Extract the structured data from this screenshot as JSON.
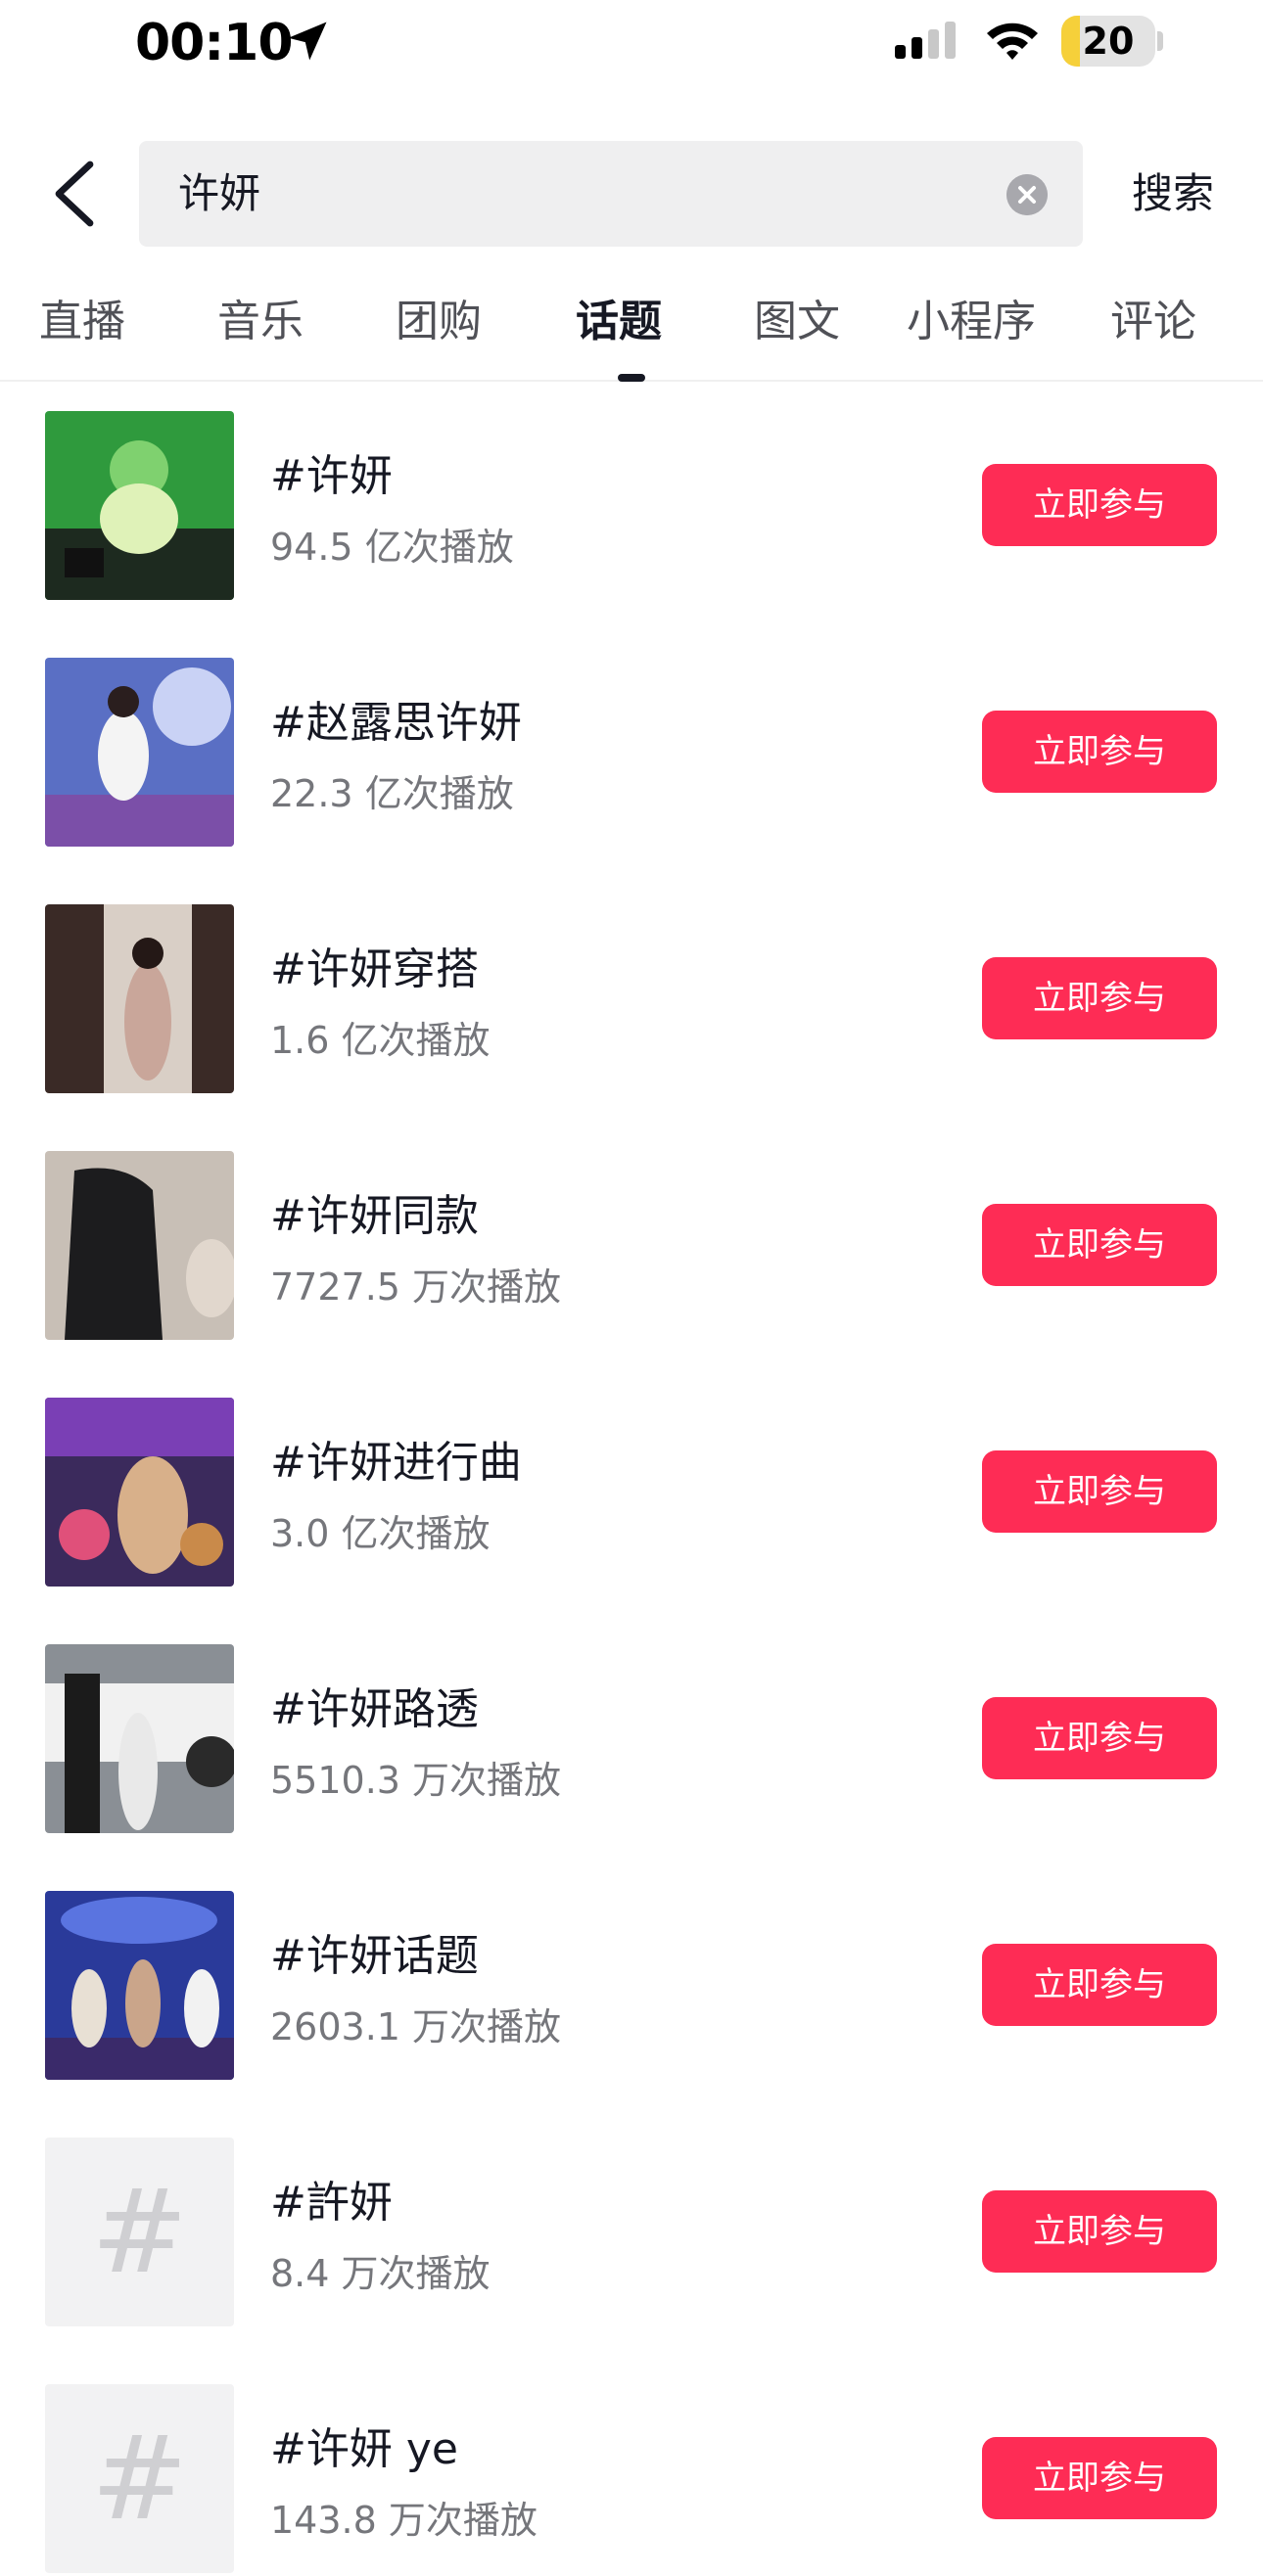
{
  "status_bar": {
    "time": "00:10",
    "battery": "20",
    "battery_level": 0.2,
    "icons": [
      "location-arrow-icon",
      "cellular-signal-icon",
      "wifi-icon",
      "battery-icon"
    ]
  },
  "search": {
    "back_icon": "chevron-left-icon",
    "query": "许妍",
    "clear_icon": "clear-circle-icon",
    "submit_label": "搜索"
  },
  "tabs": [
    {
      "label": "直播"
    },
    {
      "label": "音乐"
    },
    {
      "label": "团购"
    },
    {
      "label": "话题",
      "active": true
    },
    {
      "label": "图文"
    },
    {
      "label": "小程序"
    },
    {
      "label": "评论"
    }
  ],
  "topics": [
    {
      "title": "#许妍",
      "plays": "94.5 亿次播放",
      "thumbnail": "photo"
    },
    {
      "title": "#赵露思许妍",
      "plays": "22.3 亿次播放",
      "thumbnail": "photo"
    },
    {
      "title": "#许妍穿搭",
      "plays": "1.6 亿次播放",
      "thumbnail": "photo"
    },
    {
      "title": "#许妍同款",
      "plays": "7727.5 万次播放",
      "thumbnail": "photo"
    },
    {
      "title": "#许妍进行曲",
      "plays": "3.0 亿次播放",
      "thumbnail": "photo"
    },
    {
      "title": "#许妍路透",
      "plays": "5510.3 万次播放",
      "thumbnail": "photo"
    },
    {
      "title": "#许妍话题",
      "plays": "2603.1 万次播放",
      "thumbnail": "photo"
    },
    {
      "title": "#許妍",
      "plays": "8.4 万次播放",
      "thumbnail": "hash-placeholder"
    },
    {
      "title": "#许妍 ye",
      "plays": "143.8 万次播放",
      "thumbnail": "hash-placeholder"
    }
  ],
  "join_label": "立即参与",
  "placeholder_glyph": "#",
  "colors": {
    "accent": "#fe2c55",
    "text_primary": "#161823",
    "text_secondary": "#75767b",
    "search_bg": "#efeff0",
    "battery_fill": "#f6d03a"
  }
}
